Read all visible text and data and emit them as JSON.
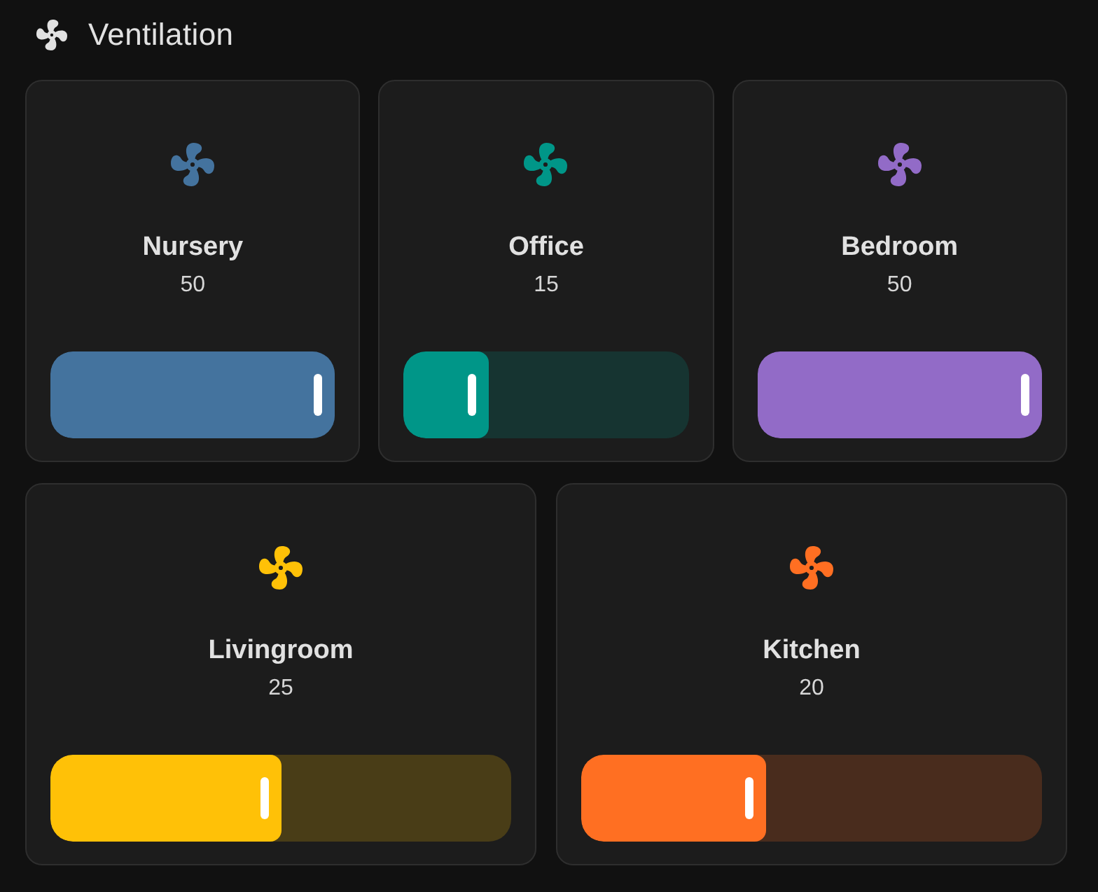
{
  "header": {
    "title": "Ventilation"
  },
  "rows": [
    {
      "cards": [
        {
          "name": "Nursery",
          "value": "50",
          "level": 1,
          "color": "#44739e"
        },
        {
          "name": "Office",
          "value": "15",
          "level": 0.3,
          "color": "#009688"
        },
        {
          "name": "Bedroom",
          "value": "50",
          "level": 1,
          "color": "#926bc7"
        }
      ]
    },
    {
      "cards": [
        {
          "name": "Livingroom",
          "value": "25",
          "level": 0.5,
          "color": "#ffc107"
        },
        {
          "name": "Kitchen",
          "value": "20",
          "level": 0.4,
          "color": "#ff6f22"
        }
      ]
    }
  ]
}
